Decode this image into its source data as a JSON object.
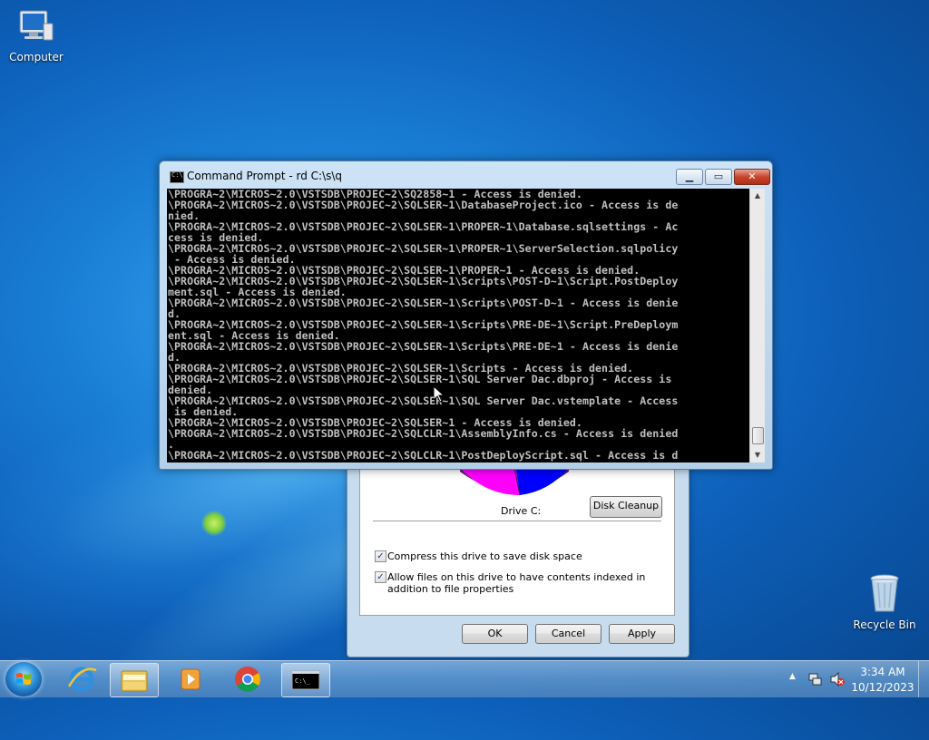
{
  "desktop": {
    "icons": [
      {
        "label": "Computer",
        "icon": "computer-icon"
      },
      {
        "label": "Recycle Bin",
        "icon": "recycle-bin-icon"
      }
    ]
  },
  "cmd_window": {
    "title": "Command Prompt - rd  C:\\s\\q",
    "lines": [
      "\\PROGRA~2\\MICROS~2.0\\VSTSDB\\PROJEC~2\\SQ2858~1 - Access is denied.",
      "\\PROGRA~2\\MICROS~2.0\\VSTSDB\\PROJEC~2\\SQLSER~1\\DatabaseProject.ico - Access is de",
      "nied.",
      "\\PROGRA~2\\MICROS~2.0\\VSTSDB\\PROJEC~2\\SQLSER~1\\PROPER~1\\Database.sqlsettings - Ac",
      "cess is denied.",
      "\\PROGRA~2\\MICROS~2.0\\VSTSDB\\PROJEC~2\\SQLSER~1\\PROPER~1\\ServerSelection.sqlpolicy",
      " - Access is denied.",
      "\\PROGRA~2\\MICROS~2.0\\VSTSDB\\PROJEC~2\\SQLSER~1\\PROPER~1 - Access is denied.",
      "\\PROGRA~2\\MICROS~2.0\\VSTSDB\\PROJEC~2\\SQLSER~1\\Scripts\\POST-D~1\\Script.PostDeploy",
      "ment.sql - Access is denied.",
      "\\PROGRA~2\\MICROS~2.0\\VSTSDB\\PROJEC~2\\SQLSER~1\\Scripts\\POST-D~1 - Access is denie",
      "d.",
      "\\PROGRA~2\\MICROS~2.0\\VSTSDB\\PROJEC~2\\SQLSER~1\\Scripts\\PRE-DE~1\\Script.PreDeploym",
      "ent.sql - Access is denied.",
      "\\PROGRA~2\\MICROS~2.0\\VSTSDB\\PROJEC~2\\SQLSER~1\\Scripts\\PRE-DE~1 - Access is denie",
      "d.",
      "\\PROGRA~2\\MICROS~2.0\\VSTSDB\\PROJEC~2\\SQLSER~1\\Scripts - Access is denied.",
      "\\PROGRA~2\\MICROS~2.0\\VSTSDB\\PROJEC~2\\SQLSER~1\\SQL Server Dac.dbproj - Access is",
      "denied.",
      "\\PROGRA~2\\MICROS~2.0\\VSTSDB\\PROJEC~2\\SQLSER~1\\SQL Server Dac.vstemplate - Access",
      " is denied.",
      "\\PROGRA~2\\MICROS~2.0\\VSTSDB\\PROJEC~2\\SQLSER~1 - Access is denied.",
      "\\PROGRA~2\\MICROS~2.0\\VSTSDB\\PROJEC~2\\SQLCLR~1\\AssemblyInfo.cs - Access is denied",
      ".",
      "\\PROGRA~2\\MICROS~2.0\\VSTSDB\\PROJEC~2\\SQLCLR~1\\PostDeployScript.sql - Access is d"
    ]
  },
  "properties_dialog": {
    "drive_label": "Drive C:",
    "disk_cleanup_label": "Disk Cleanup",
    "compress_label": "Compress this drive to save disk space",
    "compress_checked": true,
    "index_label": "Allow files on this drive to have contents indexed in addition to file properties",
    "index_checked": true,
    "ok_label": "OK",
    "cancel_label": "Cancel",
    "apply_label": "Apply",
    "pie_colors": {
      "used": "#ff00ff",
      "free": "#0000ff"
    }
  },
  "taskbar": {
    "items": [
      "internet-explorer-icon",
      "file-explorer-icon",
      "media-player-icon",
      "chrome-icon",
      "command-prompt-icon"
    ],
    "active_item": "command-prompt-icon",
    "clock_time": "3:34 AM",
    "clock_date": "10/12/2023"
  }
}
